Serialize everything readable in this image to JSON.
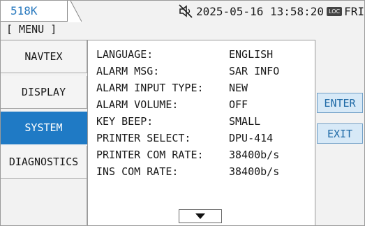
{
  "header": {
    "frequency": "518K",
    "datetime": "2025-05-16 13:58:20",
    "loc_badge": "LOC",
    "day": "FRI",
    "mute_icon": "speaker-muted-icon"
  },
  "menu_label": "[ MENU ]",
  "nav": {
    "items": [
      {
        "label": "NAVTEX"
      },
      {
        "label": "DISPLAY"
      },
      {
        "label": "SYSTEM",
        "active": true
      },
      {
        "label": "DIAGNOSTICS"
      }
    ]
  },
  "settings": [
    {
      "label": "LANGUAGE:",
      "value": "ENGLISH"
    },
    {
      "label": "ALARM MSG:",
      "value": "SAR INFO"
    },
    {
      "label": "ALARM INPUT TYPE:",
      "value": "NEW"
    },
    {
      "label": "ALARM VOLUME:",
      "value": "OFF"
    },
    {
      "label": "KEY BEEP:",
      "value": "SMALL"
    },
    {
      "label": "PRINTER SELECT:",
      "value": "DPU-414"
    },
    {
      "label": "PRINTER COM RATE:",
      "value": "38400b/s"
    },
    {
      "label": "INS COM RATE:",
      "value": "38400b/s"
    }
  ],
  "scroll_down_icon": "triangle-down-icon",
  "softkeys": {
    "enter": "ENTER",
    "exit": "EXIT"
  },
  "colors": {
    "accent": "#1f7ac5",
    "frequency_text": "#2a7abf",
    "softkey_bg": "#d7e9f7",
    "softkey_text": "#1f6aa6"
  }
}
